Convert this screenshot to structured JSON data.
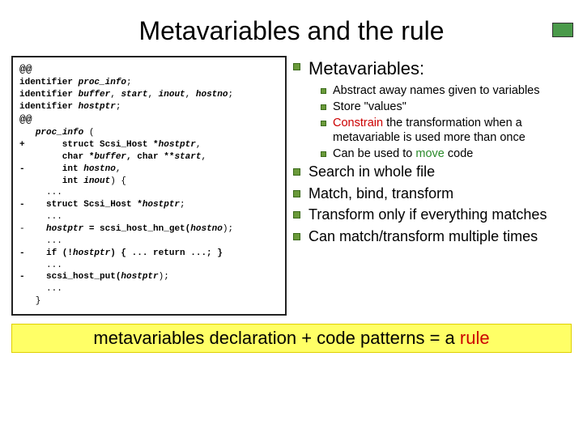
{
  "title": "Metavariables and the rule",
  "code": {
    "l1": "@@",
    "l2a": "identifier ",
    "l2b": "proc_info",
    "l2c": ";",
    "l3a": "identifier ",
    "l3b": "buffer",
    "l3c": ", ",
    "l3d": "start",
    "l3e": ", ",
    "l3f": "inout",
    "l3g": ", ",
    "l3h": "hostno",
    "l3i": ";",
    "l4a": "identifier ",
    "l4b": "hostptr",
    "l4c": ";",
    "l5": "@@",
    "l6a": "   ",
    "l6b": "proc_info",
    "l6c": " (",
    "l7a": "+       struct Scsi_Host *",
    "l7b": "hostptr",
    "l7c": ",",
    "l8a": "        char *",
    "l8b": "buffer",
    "l8c": ", char **",
    "l8d": "start",
    "l8e": ",",
    "l9a": "-       int ",
    "l9b": "hostno",
    "l9c": ",",
    "l10a": "        int ",
    "l10b": "inout",
    "l10c": ") {",
    "l11": "     ...",
    "l12a": "-    struct Scsi_Host *",
    "l12b": "hostptr",
    "l12c": ";",
    "l13": "     ...",
    "l14a": "-    ",
    "l14b": "hostptr",
    "l14c": " = scsi_host_hn_get(",
    "l14d": "hostno",
    "l14e": ");",
    "l15": "     ...",
    "l16a": "-    if (!",
    "l16b": "hostptr",
    "l16c": ") { ... return ...; }",
    "l17": "     ...",
    "l18a": "-    scsi_host_put(",
    "l18b": "hostptr",
    "l18c": ");",
    "l19": "     ...",
    "l20": "   }"
  },
  "bullets": {
    "h1": "Metavariables:",
    "s1": "Abstract away names given to variables",
    "s2": "Store \"values\"",
    "s3a": "Constrain",
    "s3b": " the transformation when a metavariable is used more than once",
    "s4a": "Can be used to ",
    "s4b": "move",
    "s4c": " code",
    "b2": "Search in whole file",
    "b3": "Match, bind, transform",
    "b4": "Transform only if everything matches",
    "b5": "Can match/transform multiple times"
  },
  "footer": {
    "a": "metavariables declaration + code patterns = a ",
    "b": "rule"
  }
}
